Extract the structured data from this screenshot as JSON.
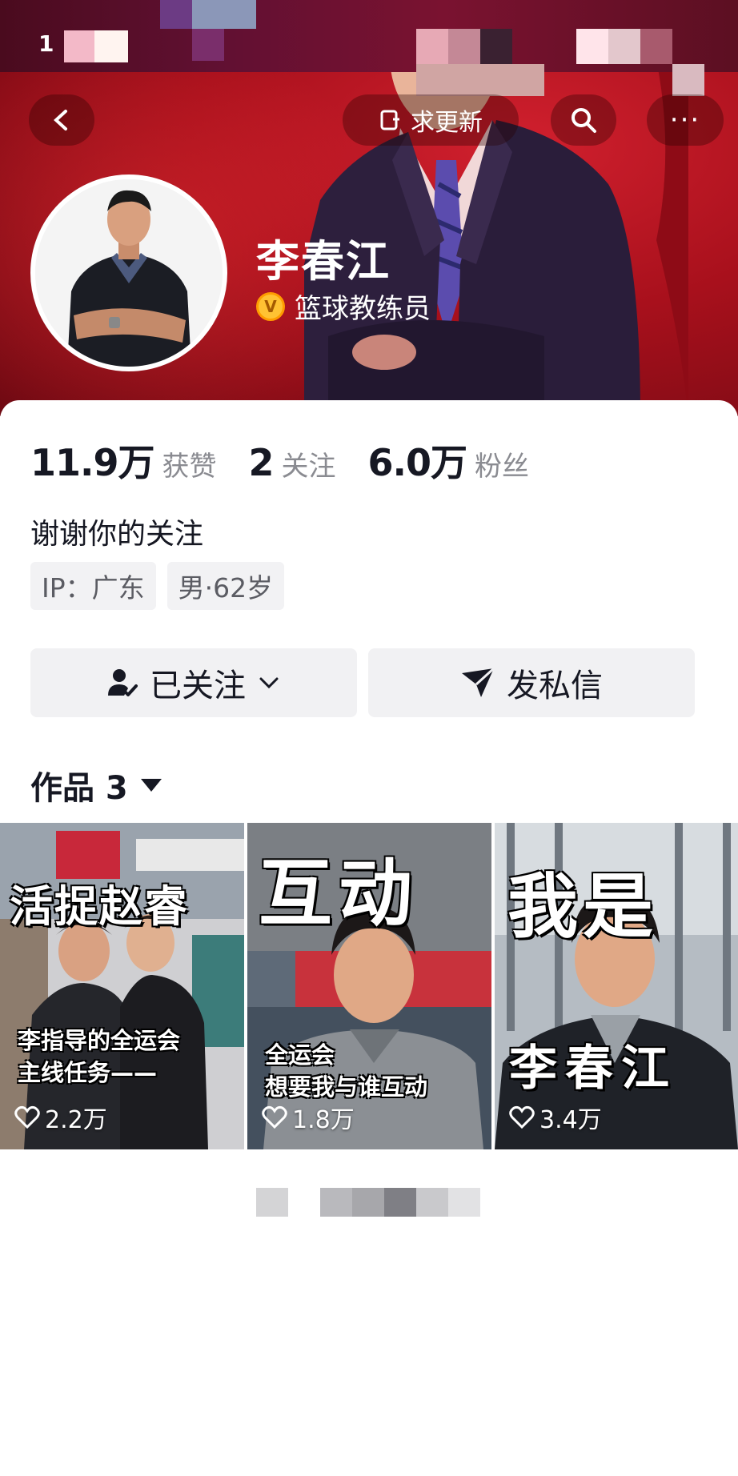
{
  "header": {
    "status_time": "1",
    "update_label": "求更新",
    "more_label": "···",
    "profile": {
      "name": "李春江",
      "verification": "篮球教练员"
    }
  },
  "stats": [
    {
      "value": "11.9万",
      "label": "获赞"
    },
    {
      "value": "2",
      "label": "关注"
    },
    {
      "value": "6.0万",
      "label": "粉丝"
    }
  ],
  "bio": "谢谢你的关注",
  "tags": [
    "IP：广东",
    "男·62岁"
  ],
  "actions": {
    "follow_label": "已关注",
    "message_label": "发私信"
  },
  "works": {
    "title": "作品 3",
    "items": [
      {
        "caption_top": "活捉赵睿",
        "caption_bottom_1": "李指导的全运会",
        "caption_bottom_2": "主线任务——",
        "likes": "2.2万"
      },
      {
        "caption_top": "互动",
        "caption_bottom_1": "全运会",
        "caption_bottom_2": "想要我与谁互动",
        "likes": "1.8万"
      },
      {
        "caption_top": "我是",
        "caption_bottom_1": "李春江",
        "likes": "3.4万"
      }
    ]
  },
  "colors": {
    "banner_red": "#a8101c",
    "verify_gold": "#ffc233",
    "text_primary": "#161823",
    "text_secondary": "#8a8b91",
    "button_bg": "#f1f1f3"
  },
  "icons": [
    "back-icon",
    "update-icon",
    "search-icon",
    "more-icon",
    "verify-badge-icon",
    "followed-user-icon",
    "chevron-down-icon",
    "send-message-icon",
    "caret-down-icon",
    "heart-icon"
  ]
}
